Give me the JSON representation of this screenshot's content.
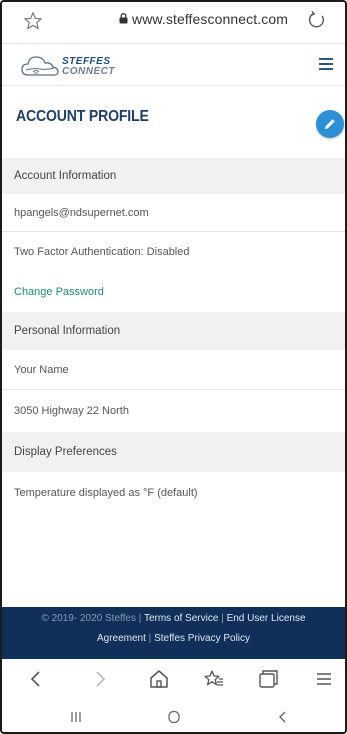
{
  "browser": {
    "url": "www.steffesconnect.com",
    "icons": [
      "star-outline-icon",
      "lock-icon",
      "reload-icon"
    ]
  },
  "site": {
    "logo_line1": "STEFFES",
    "logo_line2": "CONNECT",
    "brand_color": "#1f3e6b",
    "accent_color": "#2d8fd6"
  },
  "page": {
    "title": "ACCOUNT PROFILE"
  },
  "account": {
    "section_label": "Account Information",
    "email": "hpangels@ndsupernet.com",
    "two_factor": "Two Factor Authentication: Disabled",
    "change_password": "Change Password"
  },
  "personal": {
    "section_label": "Personal Information",
    "name": "Your Name",
    "address": "3050 Highway 22 North"
  },
  "preferences": {
    "section_label": "Display Preferences",
    "temperature": "Temperature displayed as °F (default)"
  },
  "footer": {
    "copyright": "© 2019- 2020 Steffes |",
    "terms": "Terms of Service",
    "sep1": "|",
    "eula_part1": "End User License",
    "eula_part2": "Agreement",
    "sep2": "|",
    "privacy": "Steffes Privacy Policy"
  }
}
